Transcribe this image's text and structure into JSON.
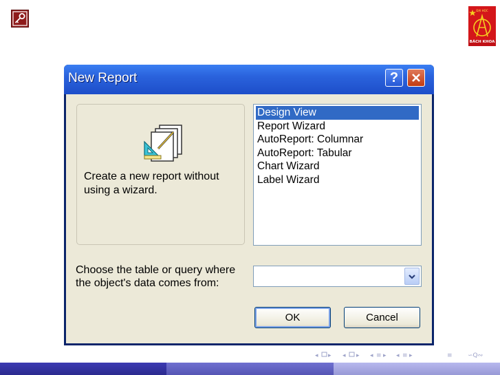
{
  "slide": {
    "key_icon": "key-icon",
    "logo": {
      "top_text": "ĐẠI HỌC",
      "bottom_text": "BÁCH KHOA"
    }
  },
  "dialog": {
    "title": "New Report",
    "help_label": "?",
    "preview_description": "Create a new report without using a wizard.",
    "options": [
      "Design View",
      "Report Wizard",
      "AutoReport:  Columnar",
      "AutoReport:  Tabular",
      "Chart Wizard",
      "Label Wizard"
    ],
    "selected_option": "Design View",
    "source_label": "Choose the table or query where the object's data comes from:",
    "source_value": "",
    "ok_label": "OK",
    "cancel_label": "Cancel"
  },
  "colors": {
    "titlebar": "#2a62dc",
    "selection": "#316ac5",
    "dialog_face": "#ece9d8",
    "footer_dark": "#2b2a8e",
    "footer_mid": "#5555b4",
    "footer_light": "#9899d6"
  }
}
